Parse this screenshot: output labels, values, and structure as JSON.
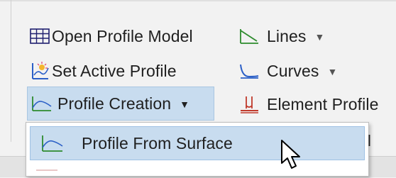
{
  "ribbon": {
    "items": {
      "open_profile_model": {
        "label": "Open Profile Model",
        "icon": "grid-table-icon"
      },
      "set_active_profile": {
        "label": "Set Active Profile",
        "icon": "active-profile-icon"
      },
      "profile_creation": {
        "label": "Profile Creation",
        "icon": "profile-curve-icon",
        "caret": "▼"
      },
      "lines": {
        "label": "Lines",
        "icon": "line-icon",
        "caret": "▼"
      },
      "curves": {
        "label": "Curves",
        "icon": "curve-icon",
        "caret": "▼"
      },
      "element_profile": {
        "label": "Element Profile",
        "icon": "element-profile-icon"
      }
    }
  },
  "dropdown": {
    "items": [
      {
        "label": "Profile From Surface",
        "icon": "profile-surface-icon"
      }
    ],
    "edge_text": "l"
  },
  "colors": {
    "hover": "#c8dcef",
    "accent_green": "#2e8b2e",
    "accent_blue": "#2b5fc7",
    "accent_red": "#c0392b"
  }
}
